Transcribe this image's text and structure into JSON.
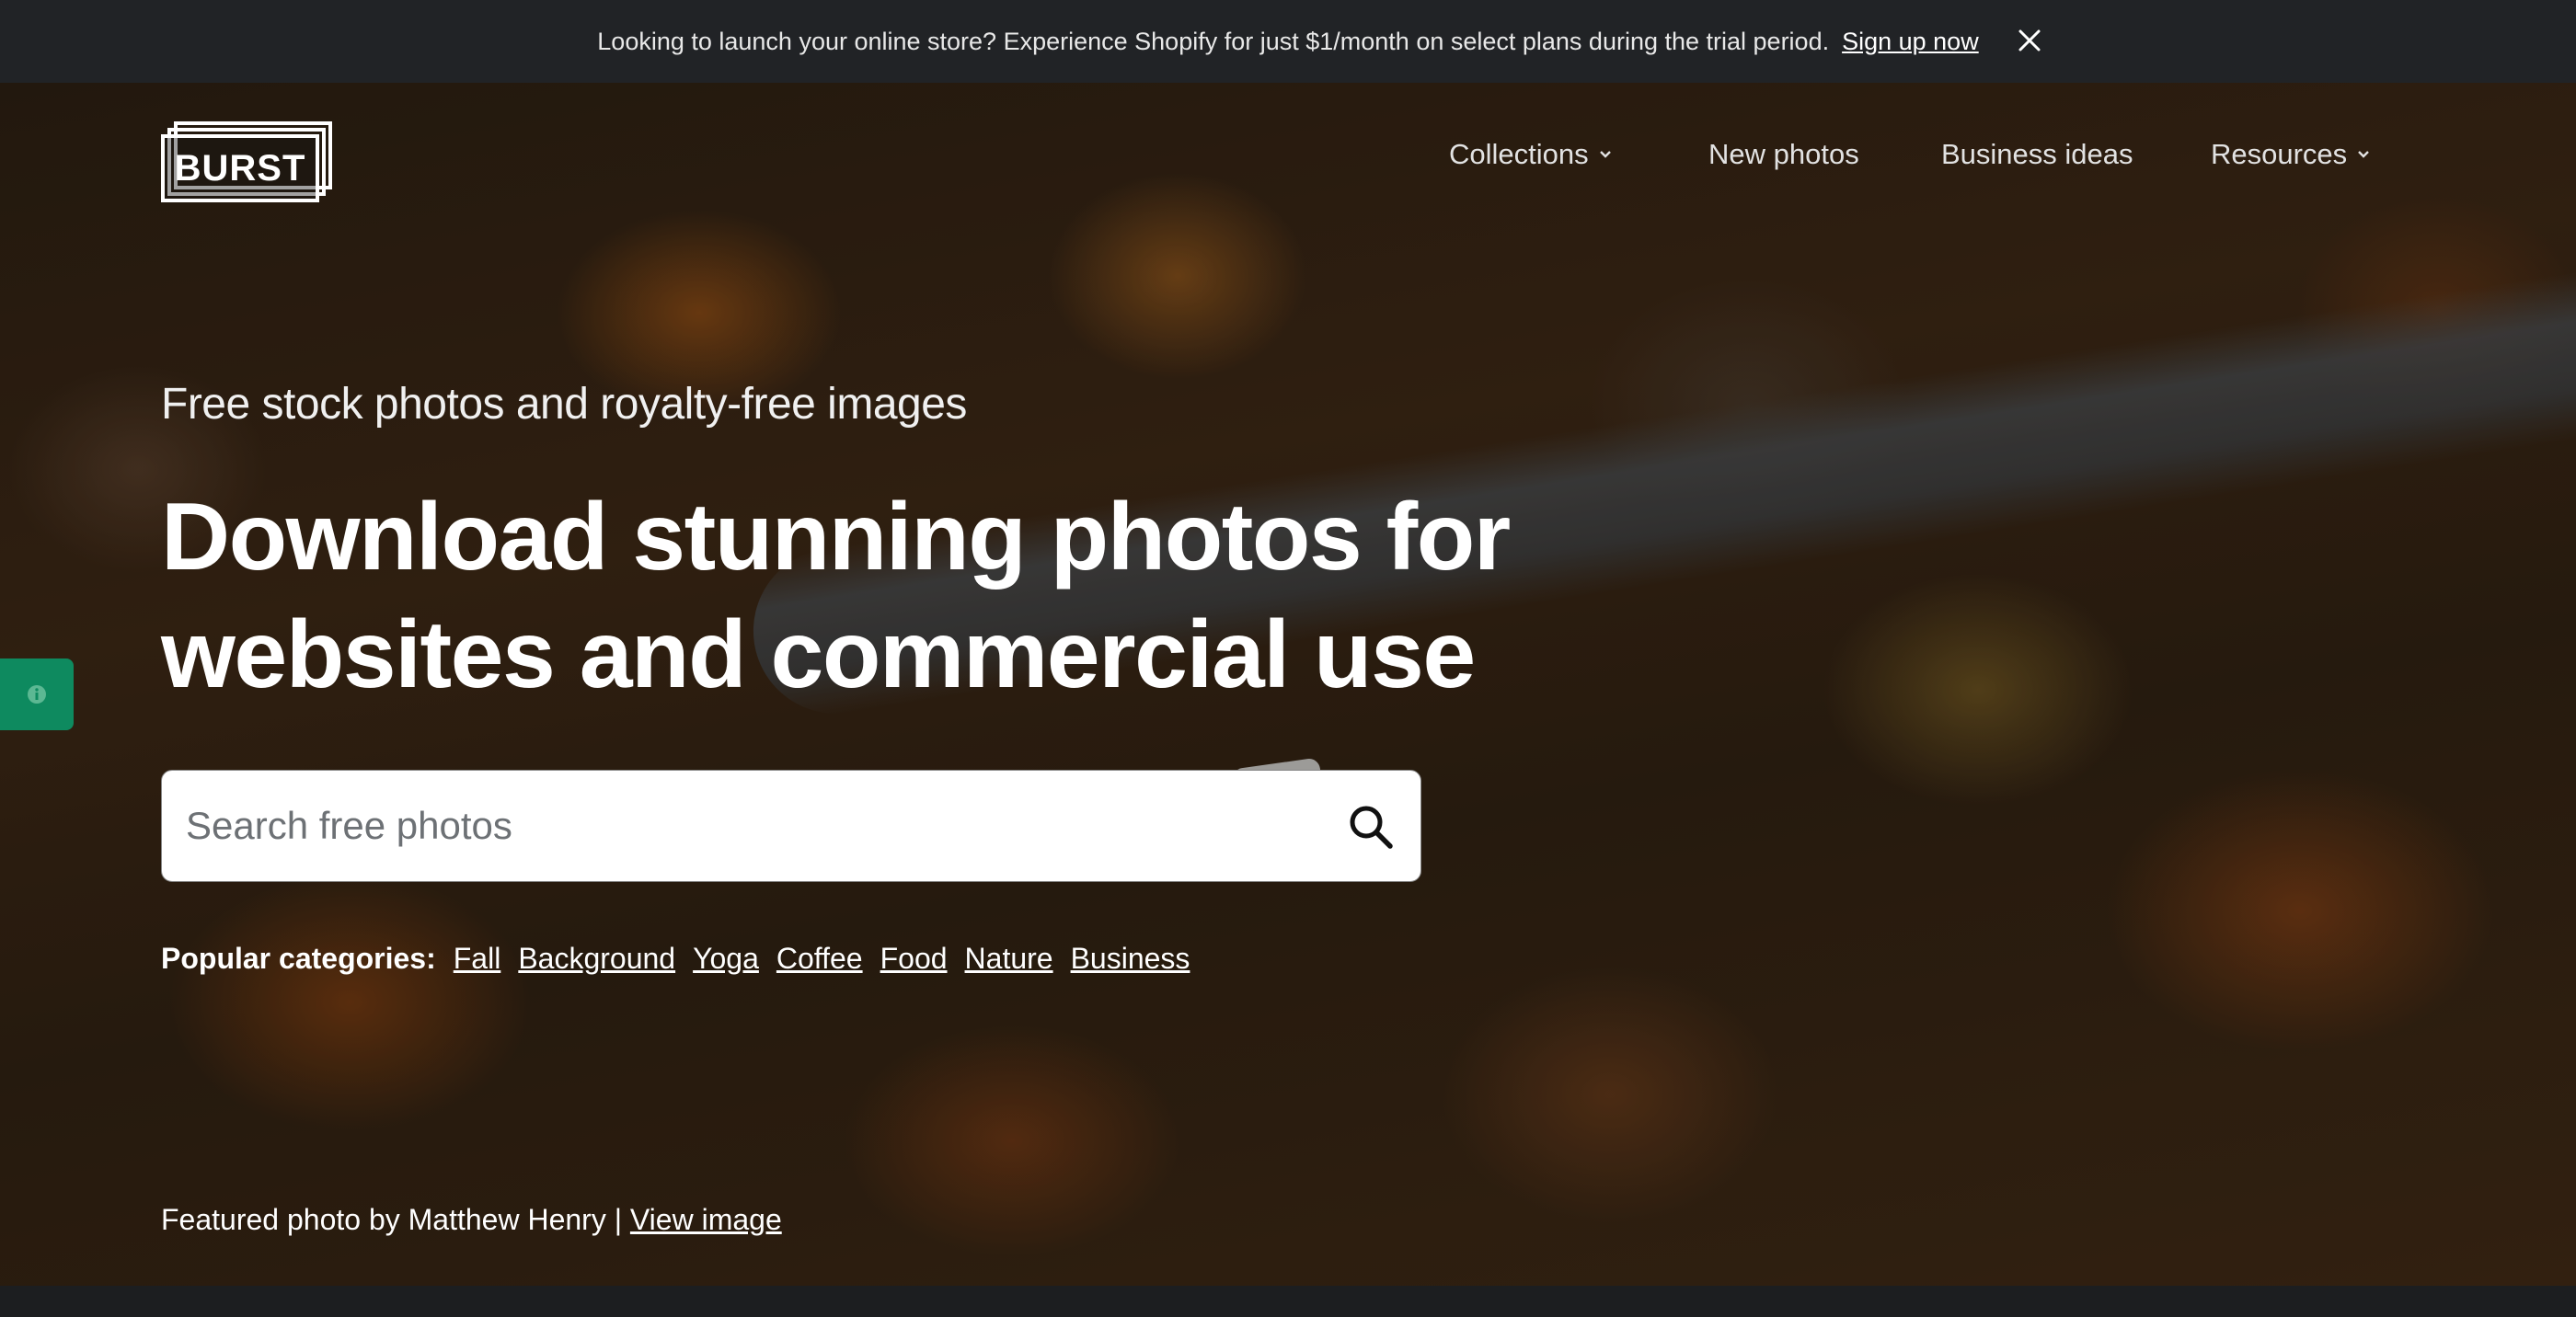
{
  "announcement": {
    "message": "Looking to launch your online store? Experience Shopify for just $1/month on select plans during the trial period.",
    "link_label": "Sign up now",
    "close_icon": "close-icon"
  },
  "header": {
    "logo_text": "BURST",
    "nav": [
      {
        "label": "Collections",
        "has_dropdown": true
      },
      {
        "label": "New photos",
        "has_dropdown": false
      },
      {
        "label": "Business ideas",
        "has_dropdown": false
      },
      {
        "label": "Resources",
        "has_dropdown": true
      }
    ]
  },
  "hero": {
    "subtitle": "Free stock photos and royalty-free images",
    "headline_line1": "Download stunning photos for",
    "headline_line2": "websites and commercial use",
    "search": {
      "placeholder": "Search free photos",
      "icon": "search-icon"
    },
    "popular": {
      "label": "Popular categories:",
      "categories": [
        "Fall",
        "Background",
        "Yoga",
        "Coffee",
        "Food",
        "Nature",
        "Business"
      ]
    },
    "featured": {
      "text": "Featured photo by Matthew Henry |",
      "link_label": "View image"
    }
  },
  "side_tab": {
    "icon": "info-icon"
  },
  "colors": {
    "announcement_bg": "#212326",
    "side_tab_bg": "#0e8a5f",
    "search_bg": "#ffffff",
    "text": "#ffffff"
  }
}
